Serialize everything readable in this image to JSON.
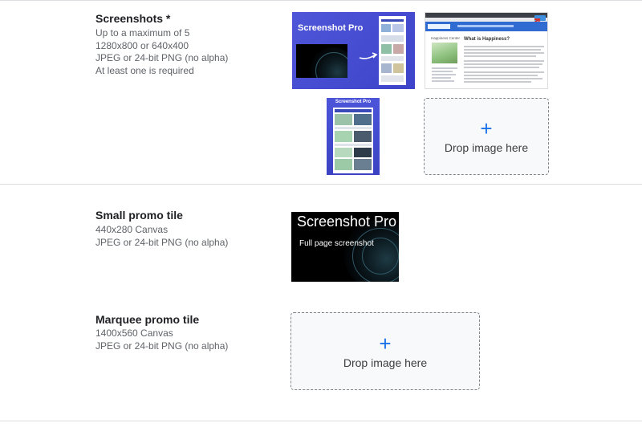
{
  "screenshots": {
    "title": "Screenshots *",
    "desc": [
      "Up to a maximum of 5",
      "1280x800 or 640x400",
      "JPEG or 24-bit PNG (no alpha)",
      "At least one is required"
    ],
    "thumb1_title": "Screenshot Pro",
    "thumb2_heading": "What is Happiness?",
    "thumb2_side": "Happiness Center",
    "thumb3_title": "Screenshot Pro",
    "drop": {
      "plus": "+",
      "label": "Drop image here"
    }
  },
  "small_promo": {
    "title": "Small promo tile",
    "desc": [
      "440x280 Canvas",
      "JPEG or 24-bit PNG (no alpha)"
    ],
    "tile_title": "Screenshot Pro",
    "tile_subtitle": "Full page screenshot"
  },
  "marquee_promo": {
    "title": "Marquee promo tile",
    "desc": [
      "1400x560 Canvas",
      "JPEG or 24-bit PNG (no alpha)"
    ],
    "drop": {
      "plus": "+",
      "label": "Drop image here"
    }
  },
  "colors": {
    "accent": "#1a73e8",
    "thumb_blue": "#4a52d6",
    "divider": "#dadce0"
  }
}
